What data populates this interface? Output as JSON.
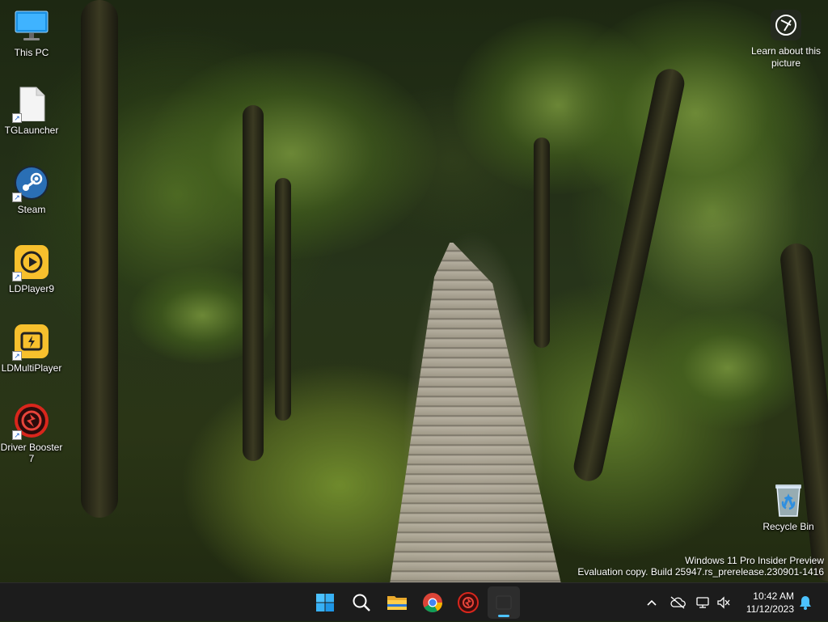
{
  "desktop": {
    "icons": [
      {
        "label": "This PC",
        "icon": "monitor-icon"
      },
      {
        "label": "TGLauncher",
        "icon": "blank-file-icon"
      },
      {
        "label": "Steam",
        "icon": "steam-icon"
      },
      {
        "label": "LDPlayer9",
        "icon": "ldplayer-icon"
      },
      {
        "label": "LDMultiPlayer",
        "icon": "ldmultiplayer-icon"
      },
      {
        "label": "Driver Booster 7",
        "icon": "driver-booster-icon"
      },
      {
        "label": "Recycle Bin",
        "icon": "recycle-bin-icon"
      }
    ],
    "learn_about": {
      "label": "Learn about this picture",
      "icon": "camera-aperture-icon"
    },
    "watermark": {
      "line1": "Windows 11 Pro Insider Preview",
      "line2": "Evaluation copy. Build 25947.rs_prerelease.230901-1416"
    }
  },
  "taskbar": {
    "apps": [
      {
        "name": "Start",
        "icon": "windows-start-icon"
      },
      {
        "name": "Search",
        "icon": "search-icon"
      },
      {
        "name": "File Explorer",
        "icon": "folder-icon"
      },
      {
        "name": "Google Chrome",
        "icon": "chrome-icon"
      },
      {
        "name": "Driver Booster",
        "icon": "driver-booster-icon"
      },
      {
        "name": "Open window",
        "icon": "window-icon",
        "active": true
      }
    ],
    "tray": {
      "icons": [
        "chevron-up-icon",
        "cloud-off-icon",
        "network-icon",
        "speaker-muted-icon",
        "notification-bell-icon"
      ],
      "time": "10:42 AM",
      "date": "11/12/2023"
    }
  },
  "colors": {
    "taskbar_bg": "#1c1c1c",
    "accent": "#4cc2ff",
    "steam": "#1b2838",
    "ldplayer": "#f7c02d",
    "driver_booster": "#d9261c"
  }
}
